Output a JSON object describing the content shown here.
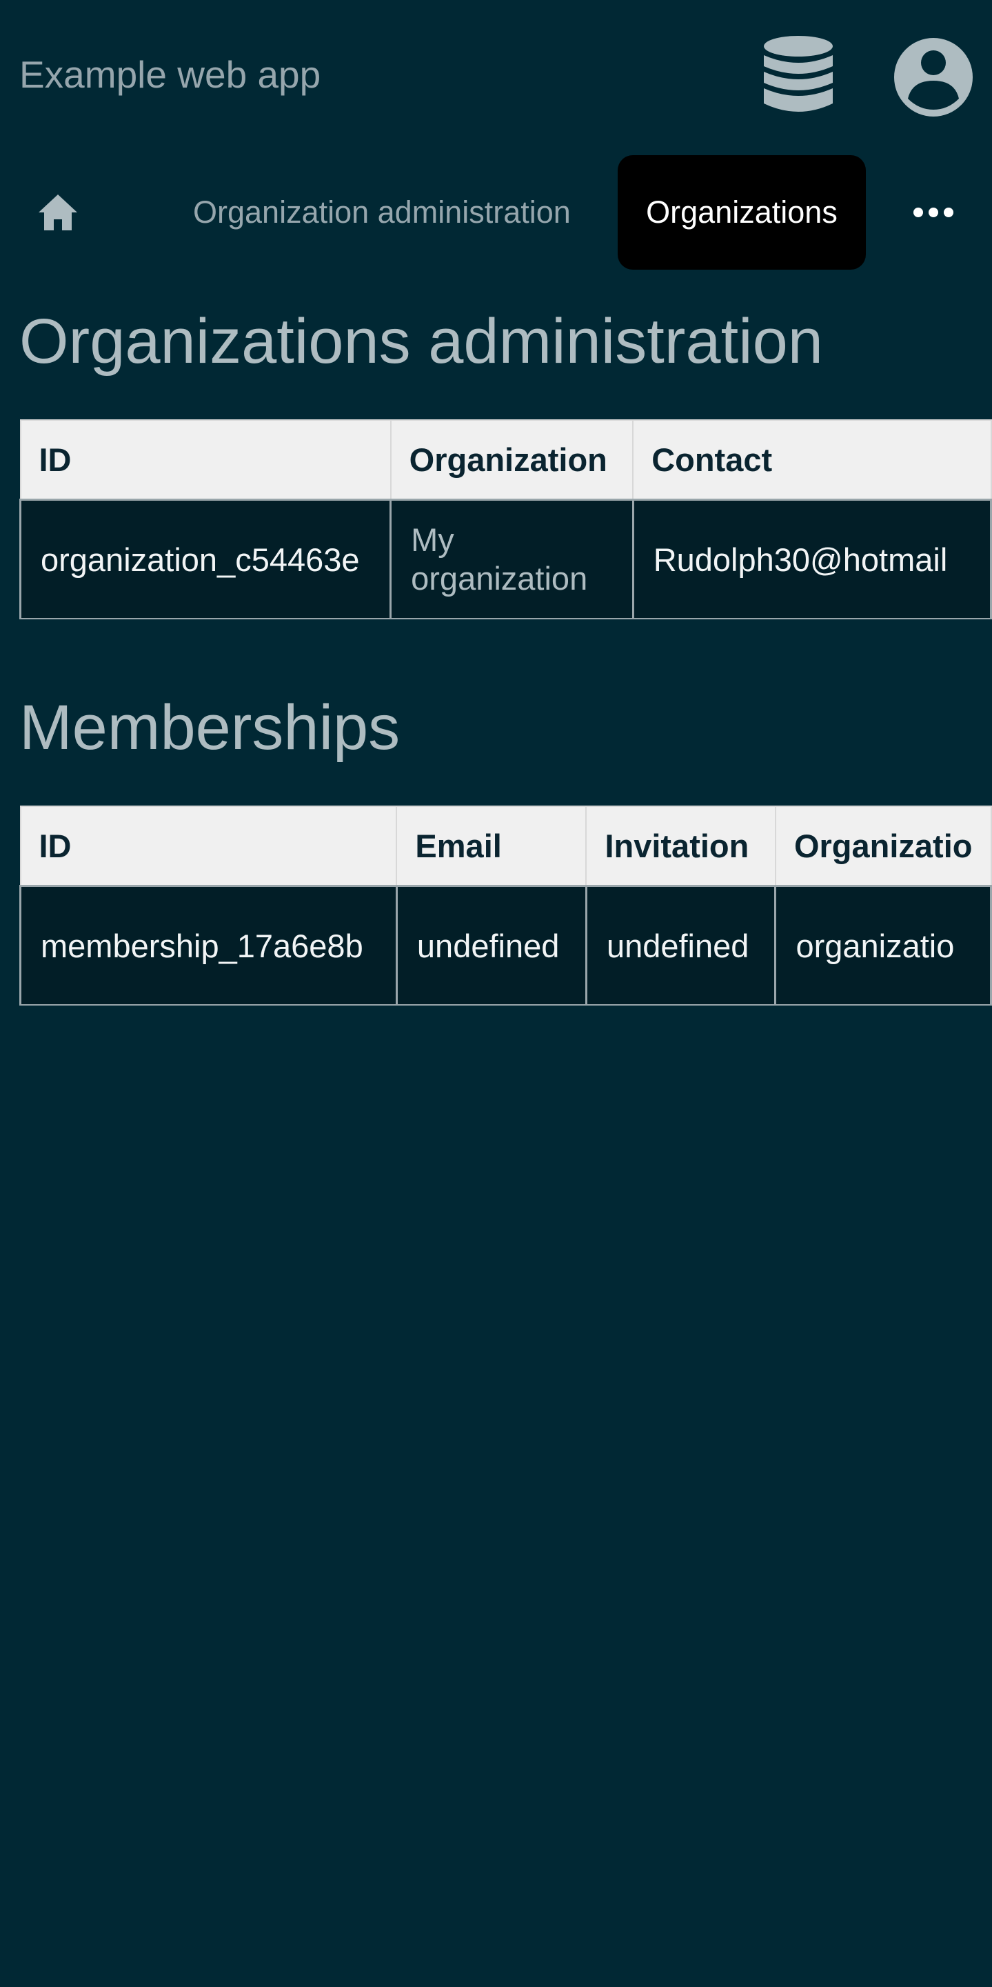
{
  "app": {
    "title": "Example web app"
  },
  "icons": {
    "database": "database-icon",
    "account": "account-circle-icon",
    "home": "home-icon",
    "more": "more-horizontal-icon"
  },
  "nav": {
    "breadcrumb": "Organization administration",
    "active_tab": "Organizations"
  },
  "organizations": {
    "heading": "Organizations administration",
    "columns": [
      "ID",
      "Organization",
      "Contact"
    ],
    "rows": [
      {
        "id": "organization_c54463e",
        "organization": "My organization",
        "contact": "Rudolph30@hotmail"
      }
    ]
  },
  "memberships": {
    "heading": "Memberships",
    "columns": [
      "ID",
      "Email",
      "Invitation",
      "Organizatio"
    ],
    "rows": [
      {
        "id": "membership_17a6e8b",
        "email": "undefined",
        "invitation": "undefined",
        "organization": "organizatio"
      }
    ]
  },
  "colors": {
    "background": "#012834",
    "header_row": "#f0f0f0",
    "cell_background": "#021e27",
    "active_tab": "#000000",
    "muted_text": "#96a6ad"
  }
}
